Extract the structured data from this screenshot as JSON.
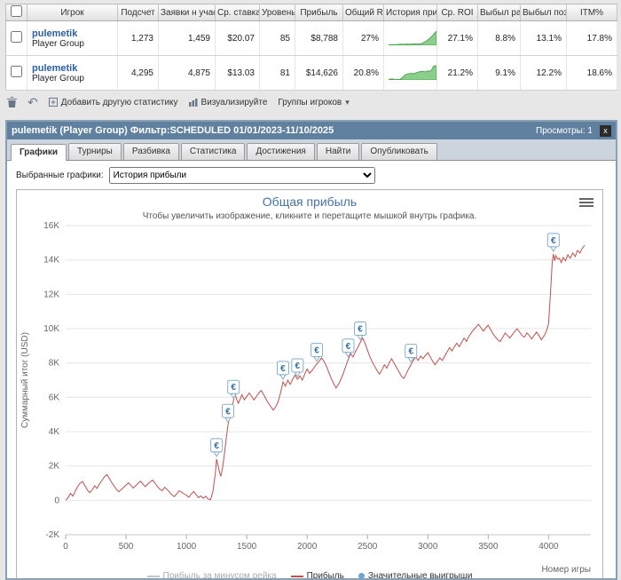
{
  "table": {
    "columns": [
      "Игрок",
      "Подсчет",
      "Заявки н участие",
      "Ср. ставка",
      "Уровень",
      "Прибыль",
      "Общий RO",
      "История приб...",
      "Ср. ROI",
      "Выбыл рано",
      "Выбыл поздн...",
      "ITM%"
    ],
    "rows": [
      {
        "player": "pulemetik",
        "group": "Player Group",
        "count": "1,273",
        "entries": "1,459",
        "avg_stake": "$20.07",
        "level": "85",
        "profit": "$8,788",
        "total_roi": "27%",
        "avg_roi": "27.1%",
        "early_bust": "8.8%",
        "late_bust": "13.1%",
        "itm": "17.8%",
        "spark": [
          0.3,
          0.5,
          0.4,
          0.8,
          0.6,
          0.9,
          0.7,
          1.0,
          0.8,
          1.2,
          2.5,
          4.5,
          7,
          10
        ]
      },
      {
        "player": "pulemetik",
        "group": "Player Group",
        "count": "4,295",
        "entries": "4,875",
        "avg_stake": "$13.03",
        "level": "81",
        "profit": "$14,626",
        "total_roi": "20.8%",
        "avg_roi": "21.2%",
        "early_bust": "9.1%",
        "late_bust": "12.2%",
        "itm": "18.6%",
        "spark": [
          0.3,
          0.7,
          0.5,
          0.4,
          0.3,
          1.8,
          3.8,
          4.2,
          4.7,
          4.4,
          5.2,
          5.8,
          6.0,
          5.7,
          6.3,
          6.2,
          9.8,
          10
        ]
      }
    ]
  },
  "toolbar": {
    "add_stat_label": "Добавить другую статистику",
    "visualize_label": "Визуализируйте",
    "groups_label": "Группы игроков"
  },
  "panel": {
    "title": "pulemetik (Player Group) Фильтр:SCHEDULED 01/01/2023-11/10/2025",
    "views_label": "Просмотры: 1",
    "close_label": "x",
    "tabs": [
      "Графики",
      "Турниры",
      "Разбивка",
      "Статистика",
      "Достижения",
      "Найти",
      "Опубликовать"
    ],
    "active_tab": "Графики",
    "selected_graphs_label": "Выбранные графики:",
    "graph_select_value": "История прибыли"
  },
  "chart_data": {
    "type": "line",
    "title": "Общая прибыль",
    "subtitle": "Чтобы увеличить изображение, кликните и перетащите мышкой внутрь графика.",
    "xlabel": "Номер игры",
    "ylabel": "Суммарный итог (USD)",
    "xlim": [
      0,
      4350
    ],
    "ylim": [
      -2000,
      16000
    ],
    "xticks": [
      0,
      500,
      1000,
      1500,
      2000,
      2500,
      3000,
      3500,
      4000
    ],
    "yticks": [
      -2000,
      0,
      2000,
      4000,
      6000,
      8000,
      10000,
      12000,
      14000,
      16000
    ],
    "ytick_labels": [
      "-2K",
      "0",
      "2K",
      "4K",
      "6K",
      "8K",
      "10K",
      "12K",
      "14K",
      "16K"
    ],
    "grid": "horizontal",
    "legend_position": "bottom",
    "legend": [
      {
        "label": "Прибыль за минусом рейка",
        "type": "line",
        "color": "#c6c6c6",
        "disabled": true
      },
      {
        "label": "Прибыль",
        "type": "line",
        "color": "#c0504d",
        "disabled": false
      },
      {
        "label": "Значительные выигрыши",
        "type": "dot",
        "color": "#6aa5d8",
        "disabled": false
      }
    ],
    "marker": {
      "symbol": "€",
      "color": "#2f6f9f",
      "border": "#85aecb"
    },
    "significant_wins_x": [
      1250,
      1345,
      1390,
      1800,
      1920,
      2080,
      2340,
      2440,
      2860,
      4040
    ],
    "series": [
      {
        "name": "Прибыль",
        "color": "#c0504d",
        "points": [
          [
            0,
            0
          ],
          [
            20,
            150
          ],
          [
            40,
            400
          ],
          [
            60,
            250
          ],
          [
            80,
            550
          ],
          [
            100,
            800
          ],
          [
            120,
            1000
          ],
          [
            140,
            1100
          ],
          [
            160,
            850
          ],
          [
            180,
            600
          ],
          [
            200,
            450
          ],
          [
            220,
            600
          ],
          [
            240,
            850
          ],
          [
            260,
            700
          ],
          [
            280,
            950
          ],
          [
            300,
            1150
          ],
          [
            320,
            1350
          ],
          [
            340,
            1500
          ],
          [
            360,
            1300
          ],
          [
            380,
            1050
          ],
          [
            400,
            850
          ],
          [
            420,
            650
          ],
          [
            440,
            500
          ],
          [
            460,
            620
          ],
          [
            480,
            750
          ],
          [
            500,
            880
          ],
          [
            520,
            1020
          ],
          [
            540,
            880
          ],
          [
            560,
            720
          ],
          [
            580,
            850
          ],
          [
            600,
            1000
          ],
          [
            620,
            1120
          ],
          [
            640,
            950
          ],
          [
            660,
            800
          ],
          [
            680,
            950
          ],
          [
            700,
            1080
          ],
          [
            720,
            1180
          ],
          [
            740,
            1000
          ],
          [
            760,
            820
          ],
          [
            780,
            650
          ],
          [
            800,
            560
          ],
          [
            820,
            760
          ],
          [
            840,
            640
          ],
          [
            860,
            480
          ],
          [
            880,
            320
          ],
          [
            900,
            220
          ],
          [
            920,
            380
          ],
          [
            940,
            560
          ],
          [
            960,
            480
          ],
          [
            980,
            380
          ],
          [
            1000,
            300
          ],
          [
            1020,
            180
          ],
          [
            1040,
            360
          ],
          [
            1060,
            520
          ],
          [
            1080,
            340
          ],
          [
            1100,
            160
          ],
          [
            1120,
            260
          ],
          [
            1140,
            120
          ],
          [
            1160,
            240
          ],
          [
            1180,
            80
          ],
          [
            1200,
            40
          ],
          [
            1220,
            500
          ],
          [
            1240,
            1600
          ],
          [
            1250,
            2400
          ],
          [
            1260,
            2100
          ],
          [
            1272,
            1700
          ],
          [
            1285,
            1400
          ],
          [
            1300,
            1900
          ],
          [
            1315,
            2700
          ],
          [
            1330,
            3600
          ],
          [
            1345,
            4400
          ],
          [
            1360,
            4900
          ],
          [
            1375,
            5300
          ],
          [
            1390,
            5800
          ],
          [
            1400,
            6300
          ],
          [
            1415,
            5900
          ],
          [
            1430,
            5650
          ],
          [
            1445,
            5900
          ],
          [
            1460,
            6150
          ],
          [
            1480,
            5850
          ],
          [
            1500,
            6050
          ],
          [
            1520,
            6250
          ],
          [
            1540,
            6050
          ],
          [
            1560,
            5850
          ],
          [
            1580,
            6050
          ],
          [
            1600,
            6250
          ],
          [
            1620,
            6400
          ],
          [
            1640,
            6150
          ],
          [
            1660,
            5900
          ],
          [
            1680,
            5650
          ],
          [
            1700,
            5450
          ],
          [
            1720,
            5250
          ],
          [
            1740,
            5450
          ],
          [
            1760,
            5750
          ],
          [
            1780,
            6250
          ],
          [
            1800,
            6900
          ],
          [
            1820,
            6650
          ],
          [
            1840,
            7000
          ],
          [
            1860,
            6750
          ],
          [
            1880,
            7050
          ],
          [
            1900,
            7300
          ],
          [
            1920,
            7050
          ],
          [
            1940,
            7250
          ],
          [
            1960,
            7000
          ],
          [
            1980,
            7350
          ],
          [
            2000,
            7650
          ],
          [
            2020,
            7400
          ],
          [
            2040,
            7550
          ],
          [
            2060,
            7750
          ],
          [
            2080,
            7950
          ],
          [
            2100,
            8100
          ],
          [
            2120,
            8300
          ],
          [
            2140,
            8100
          ],
          [
            2160,
            7800
          ],
          [
            2180,
            7450
          ],
          [
            2200,
            7100
          ],
          [
            2220,
            6800
          ],
          [
            2240,
            6550
          ],
          [
            2260,
            6750
          ],
          [
            2280,
            7050
          ],
          [
            2300,
            7400
          ],
          [
            2320,
            7800
          ],
          [
            2340,
            8200
          ],
          [
            2360,
            8550
          ],
          [
            2380,
            8350
          ],
          [
            2400,
            8650
          ],
          [
            2420,
            8900
          ],
          [
            2440,
            9200
          ],
          [
            2460,
            9450
          ],
          [
            2480,
            9150
          ],
          [
            2500,
            8750
          ],
          [
            2520,
            8350
          ],
          [
            2540,
            8050
          ],
          [
            2560,
            7800
          ],
          [
            2580,
            7550
          ],
          [
            2600,
            7350
          ],
          [
            2620,
            7600
          ],
          [
            2640,
            7900
          ],
          [
            2660,
            7700
          ],
          [
            2680,
            8000
          ],
          [
            2700,
            8250
          ],
          [
            2720,
            8000
          ],
          [
            2740,
            7750
          ],
          [
            2760,
            7500
          ],
          [
            2780,
            7250
          ],
          [
            2800,
            7100
          ],
          [
            2820,
            7350
          ],
          [
            2840,
            7650
          ],
          [
            2860,
            7900
          ],
          [
            2880,
            8150
          ],
          [
            2900,
            8350
          ],
          [
            2920,
            8150
          ],
          [
            2940,
            8400
          ],
          [
            2960,
            8250
          ],
          [
            2980,
            8450
          ],
          [
            3000,
            8600
          ],
          [
            3020,
            8350
          ],
          [
            3040,
            8100
          ],
          [
            3060,
            7900
          ],
          [
            3080,
            8100
          ],
          [
            3100,
            8300
          ],
          [
            3120,
            8150
          ],
          [
            3140,
            8400
          ],
          [
            3160,
            8650
          ],
          [
            3180,
            8900
          ],
          [
            3200,
            8700
          ],
          [
            3220,
            8950
          ],
          [
            3240,
            9150
          ],
          [
            3260,
            8950
          ],
          [
            3280,
            9200
          ],
          [
            3300,
            9450
          ],
          [
            3320,
            9250
          ],
          [
            3340,
            9550
          ],
          [
            3360,
            9750
          ],
          [
            3380,
            9950
          ],
          [
            3400,
            10100
          ],
          [
            3420,
            10250
          ],
          [
            3440,
            10050
          ],
          [
            3460,
            9850
          ],
          [
            3480,
            10050
          ],
          [
            3500,
            10200
          ],
          [
            3520,
            9950
          ],
          [
            3540,
            9700
          ],
          [
            3560,
            9500
          ],
          [
            3580,
            9350
          ],
          [
            3600,
            9250
          ],
          [
            3620,
            9500
          ],
          [
            3640,
            9750
          ],
          [
            3660,
            9600
          ],
          [
            3680,
            9450
          ],
          [
            3700,
            9650
          ],
          [
            3720,
            9850
          ],
          [
            3740,
            10000
          ],
          [
            3760,
            9800
          ],
          [
            3780,
            9600
          ],
          [
            3800,
            9500
          ],
          [
            3820,
            9750
          ],
          [
            3840,
            9600
          ],
          [
            3860,
            9400
          ],
          [
            3880,
            9600
          ],
          [
            3900,
            9800
          ],
          [
            3920,
            9600
          ],
          [
            3940,
            9350
          ],
          [
            3960,
            9550
          ],
          [
            3980,
            9800
          ],
          [
            4000,
            10300
          ],
          [
            4010,
            11400
          ],
          [
            4020,
            12600
          ],
          [
            4030,
            13900
          ],
          [
            4040,
            14350
          ],
          [
            4050,
            13950
          ],
          [
            4060,
            14250
          ],
          [
            4075,
            14050
          ],
          [
            4090,
            14100
          ],
          [
            4105,
            13850
          ],
          [
            4120,
            14150
          ],
          [
            4140,
            13950
          ],
          [
            4160,
            14300
          ],
          [
            4180,
            14100
          ],
          [
            4200,
            14400
          ],
          [
            4220,
            14200
          ],
          [
            4240,
            14550
          ],
          [
            4260,
            14400
          ],
          [
            4280,
            14700
          ],
          [
            4300,
            14850
          ]
        ]
      }
    ]
  }
}
